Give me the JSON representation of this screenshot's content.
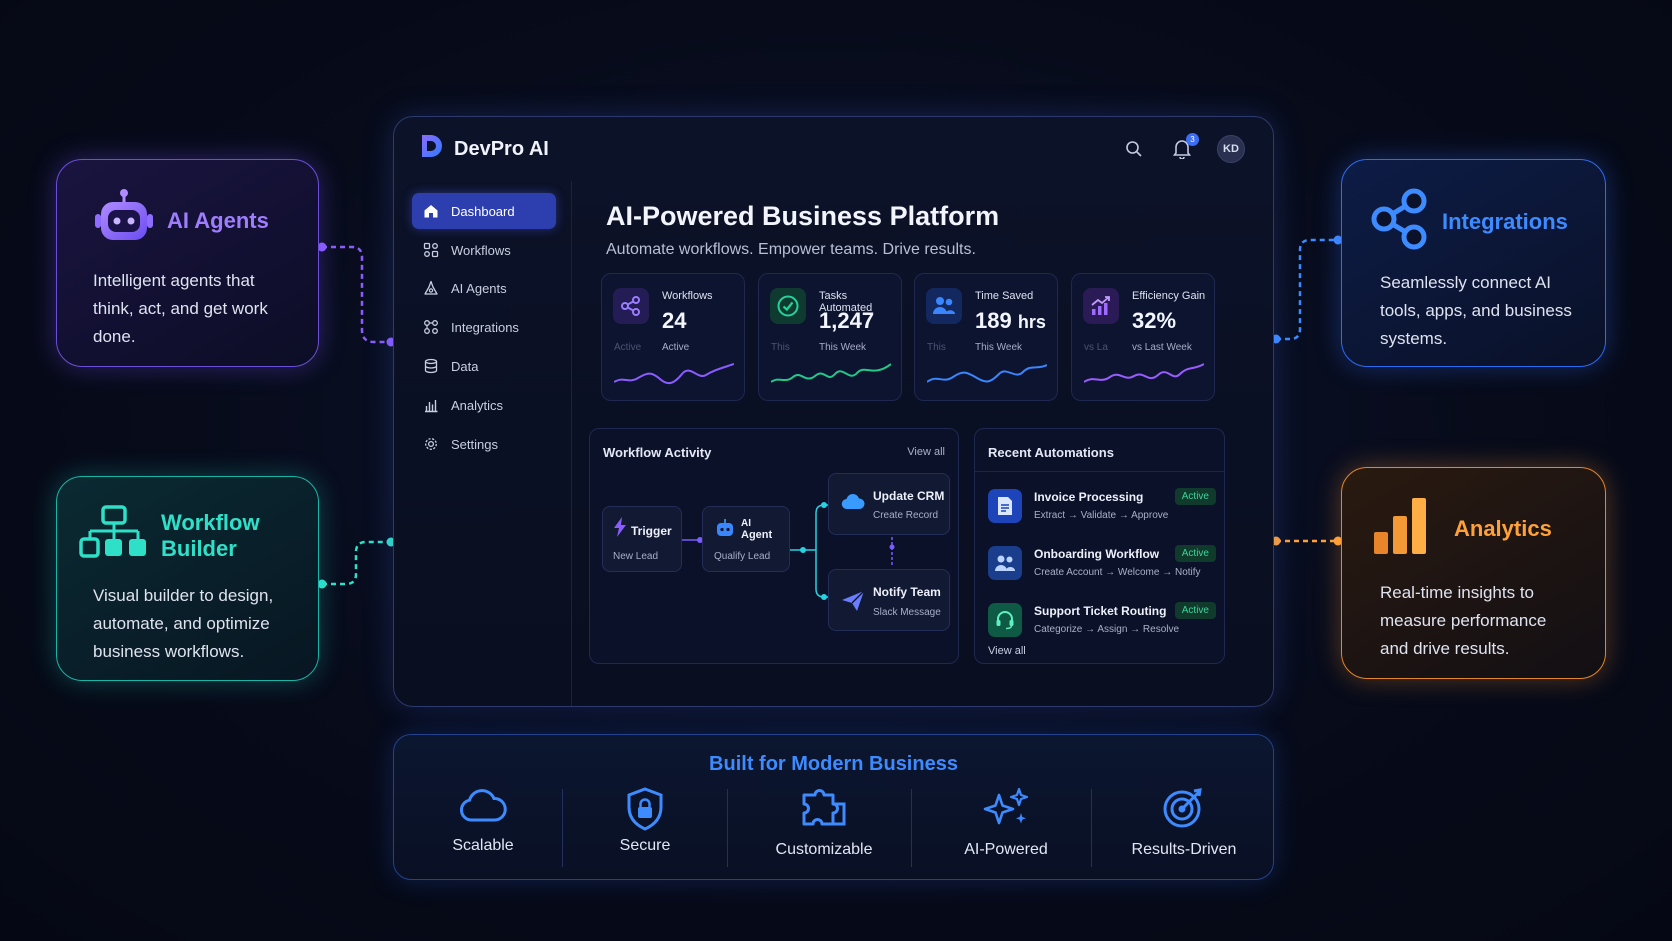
{
  "features": {
    "agents": {
      "title": "AI Agents",
      "desc": "Intelligent agents that think, act, and get work done."
    },
    "workflow_builder": {
      "title": "Workflow Builder",
      "desc": "Visual builder to design, automate, and optimize business workflows."
    },
    "integrations": {
      "title": "Integrations",
      "desc": "Seamlessly connect AI tools, apps, and business systems."
    },
    "analytics": {
      "title": "Analytics",
      "desc": "Real-time insights to measure performance and drive results."
    }
  },
  "app": {
    "name": "DevPro AI",
    "notifications_count": "3",
    "avatar_initials": "KD"
  },
  "sidebar": {
    "items": [
      {
        "label": "Dashboard",
        "icon": "home-icon"
      },
      {
        "label": "Workflows",
        "icon": "workflow-icon"
      },
      {
        "label": "AI Agents",
        "icon": "agent-icon"
      },
      {
        "label": "Integrations",
        "icon": "integrations-icon"
      },
      {
        "label": "Data",
        "icon": "database-icon"
      },
      {
        "label": "Analytics",
        "icon": "analytics-icon"
      },
      {
        "label": "Settings",
        "icon": "gear-icon"
      }
    ]
  },
  "hero": {
    "title": "AI-Powered Business Platform",
    "subtitle": "Automate workflows. Empower teams. Drive results."
  },
  "stats": [
    {
      "label": "Workflows",
      "value": "24",
      "sub": "Active",
      "ghost": "Active",
      "color": "#7b5cff"
    },
    {
      "label": "Tasks Automated",
      "value": "1,247",
      "sub": "This Week",
      "ghost": "This",
      "color": "#20c98a"
    },
    {
      "label": "Time Saved",
      "value": "189",
      "unit": "hrs",
      "sub": "This Week",
      "ghost": "This",
      "color": "#3a86ff"
    },
    {
      "label": "Efficiency Gain",
      "value": "32%",
      "sub": "vs Last Week",
      "ghost": "vs La",
      "color": "#9a5cff"
    }
  ],
  "activity": {
    "title": "Workflow Activity",
    "view_all": "View all",
    "nodes": {
      "trigger": {
        "title": "Trigger",
        "sub": "New Lead"
      },
      "agent": {
        "title_line1": "AI",
        "title_line2": "Agent",
        "sub": "Qualify Lead"
      },
      "crm": {
        "title": "Update CRM",
        "sub": "Create Record"
      },
      "notify": {
        "title": "Notify Team",
        "sub": "Slack Message"
      }
    }
  },
  "automations": {
    "title": "Recent Automations",
    "view_all": "View all",
    "items": [
      {
        "title": "Invoice Processing",
        "sub": "Extract → Validate → Approve",
        "status": "Active"
      },
      {
        "title": "Onboarding Workflow",
        "sub": "Create Account → Welcome → Notify",
        "status": "Active"
      },
      {
        "title": "Support Ticket Routing",
        "sub": "Categorize → Assign → Resolve",
        "status": "Active"
      }
    ]
  },
  "bottom": {
    "title": "Built for Modern Business",
    "items": [
      {
        "label": "Scalable",
        "icon": "cloud-icon"
      },
      {
        "label": "Secure",
        "icon": "shield-lock-icon"
      },
      {
        "label": "Customizable",
        "icon": "puzzle-icon"
      },
      {
        "label": "AI-Powered",
        "icon": "sparkles-icon"
      },
      {
        "label": "Results-Driven",
        "icon": "target-icon"
      }
    ]
  }
}
